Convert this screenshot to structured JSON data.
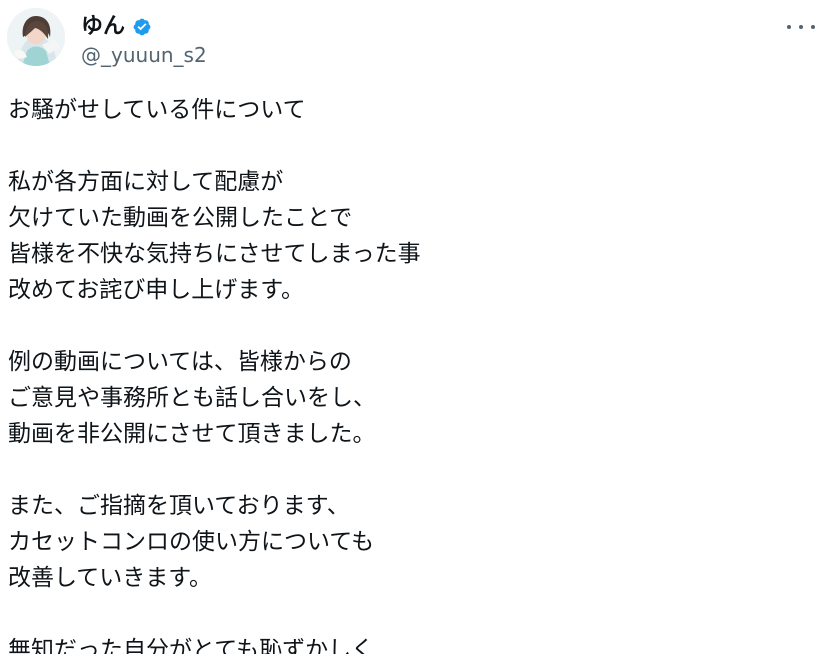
{
  "user": {
    "display_name": "ゆん",
    "handle": "@_yuuun_s2",
    "verified": true,
    "verified_color": "#1d9bf0"
  },
  "icons": {
    "avatar": "profile-avatar",
    "verified": "verified-badge-icon",
    "more": "more-options-icon"
  },
  "tweet": {
    "lines": [
      "お騒がせしている件について",
      "",
      "私が各方面に対して配慮が",
      "欠けていた動画を公開したことで",
      "皆様を不快な気持ちにさせてしまった事",
      "改めてお詫び申し上げます。",
      "",
      "例の動画については、皆様からの",
      "ご意見や事務所とも話し合いをし、",
      "動画を非公開にさせて頂きました。",
      "",
      "また、ご指摘を頂いております、",
      "カセットコンロの使い方についても",
      "改善していきます。",
      "",
      "無知だった自分がとても恥ずかしく"
    ]
  }
}
